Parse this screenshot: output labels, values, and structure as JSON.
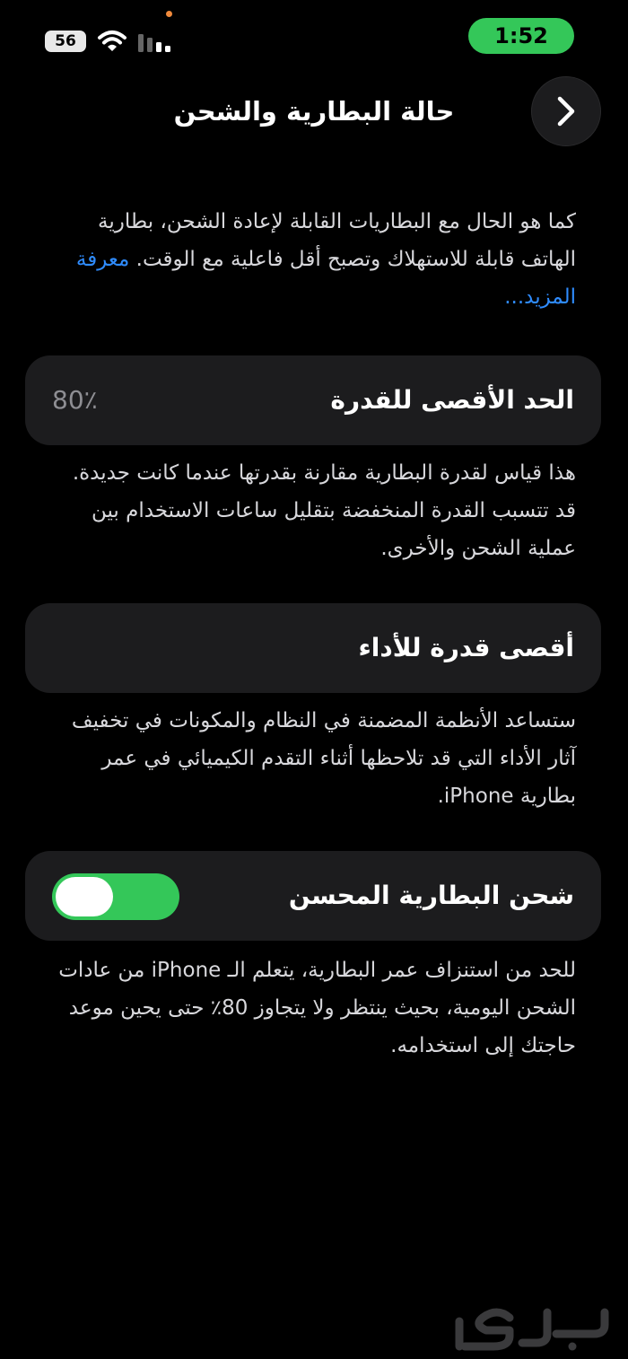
{
  "status_bar": {
    "signal_badge": "56",
    "time": "1:52",
    "icons": [
      "signal-badge",
      "wifi-icon",
      "cellular-bars-icon"
    ],
    "time_pill_color": "#34c759"
  },
  "nav": {
    "title": "حالة البطارية والشحن",
    "back_icon": "chevron-right-icon"
  },
  "intro": {
    "text": "كما هو الحال مع البطاريات القابلة لإعادة الشحن، بطارية الهاتف قابلة للاستهلاك وتصبح أقل فاعلية مع الوقت. ",
    "link": "معرفة المزيد..."
  },
  "max_capacity": {
    "label": "الحد الأقصى للقدرة",
    "value": "80٪",
    "description": "هذا قياس لقدرة البطارية مقارنة بقدرتها عندما كانت جديدة. قد تتسبب القدرة المنخفضة بتقليل ساعات الاستخدام بين عملية الشحن والأخرى."
  },
  "peak_performance": {
    "label": "أقصى قدرة للأداء",
    "description": "ستساعد الأنظمة المضمنة في النظام والمكونات في تخفيف آثار الأداء التي قد تلاحظها أثناء التقدم الكيميائي في عمر بطارية iPhone."
  },
  "optimized_charging": {
    "label": "شحن البطارية المحسن",
    "enabled": true,
    "description": "للحد من استنزاف عمر البطارية، يتعلم الـ iPhone من عادات الشحن اليومية، بحيث ينتظر ولا يتجاوز 80٪ حتى يحين موعد حاجتك إلى استخدامه."
  },
  "colors": {
    "background": "#000000",
    "card": "#1c1c1e",
    "accent_link": "#2f8cff",
    "toggle_on": "#34c759"
  }
}
